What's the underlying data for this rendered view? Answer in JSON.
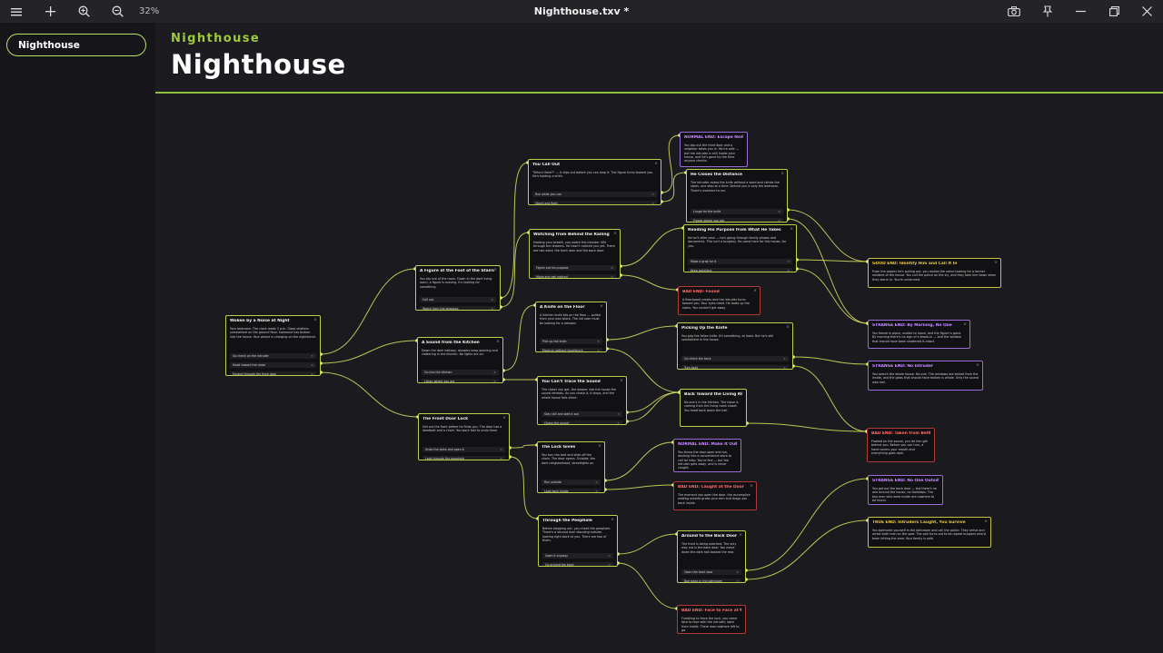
{
  "window": {
    "title": "Nighthouse.txv *",
    "zoom": "32%"
  },
  "toolbar": {
    "icons": [
      "menu-icon",
      "plus-icon",
      "zoom-in-icon",
      "zoom-out-icon",
      "camera-icon",
      "pin-icon",
      "minimize-icon",
      "restore-icon",
      "close-icon"
    ]
  },
  "sidebar": {
    "items": [
      {
        "label": "Nighthouse"
      }
    ]
  },
  "header": {
    "subtitle": "Nighthouse",
    "title": "Nighthouse"
  },
  "colors": {
    "accent": "#9ecb3c",
    "node_border": "#b8d245",
    "edge": "#d8e060",
    "normal_end": "#c58cff",
    "bad_end": "#ff6a6a",
    "good_end": "#e8c640",
    "strange_end": "#c58cff",
    "true_end": "#e8c640"
  },
  "nodes": [
    {
      "id": "n1",
      "kind": "story",
      "title": "Woken by a Noise at Night",
      "body": "Your bedroom. The clock reads 3 a.m. Glass shatters somewhere on the ground floor. Someone has broken into the house. Your phone is charging on the nightstand.",
      "choices": [
        "Go check on the intruder",
        "Head toward the noise",
        "Escape through the front door"
      ]
    },
    {
      "id": "n2",
      "kind": "story",
      "title": "A Figure at the Foot of the Stairs",
      "body": "You slip out of the room. Down in the dark living room, a figure is moving. It's looking for something.",
      "choices": [
        "Call out",
        "Watch from the shadows"
      ]
    },
    {
      "id": "n3",
      "kind": "story",
      "title": "A Sound from the Kitchen",
      "body": "Down the dark hallway, drawers keep opening and clattering in the kitchen. No lights are on.",
      "choices": [
        "Go into the kitchen",
        "Listen where you are"
      ]
    },
    {
      "id": "n4",
      "kind": "story",
      "title": "The Front Door Lock",
      "body": "Get out the front before he finds you. The door has a deadbolt and a chain. You work fast to undo them.",
      "choices": [
        "Undo the locks and open it",
        "Look through the peephole"
      ]
    },
    {
      "id": "n5",
      "kind": "story",
      "title": "You Call Out",
      "body": "\"Who's there?\" — It slips out before you can stop it. The figure turns toward you. He's holding a knife.",
      "choices": [
        "Run while you can",
        "Stand and fight"
      ]
    },
    {
      "id": "n6",
      "kind": "story",
      "title": "Watching from Behind the Railing",
      "body": "Holding your breath, you watch the intruder rifle through the drawers. He hasn't noticed you yet. There are two exits: the front door and the back door.",
      "choices": [
        "Figure out his purpose",
        "Move and get noticed"
      ]
    },
    {
      "id": "n7",
      "kind": "story",
      "title": "A Knife on the Floor",
      "body": "A kitchen knife lies on the floor — pulled from your own block. The intruder must be looking for a weapon.",
      "choices": [
        "Pick up the knife",
        "Move on without touching it"
      ]
    },
    {
      "id": "n8",
      "kind": "story",
      "title": "You Can't Trace the Sound",
      "body": "The closer you get, the deeper into the house the sound retreats. As you chase it, it stops, and the whole house falls silent.",
      "choices": [
        "Stay still and wait it out",
        "Chase the sound"
      ]
    },
    {
      "id": "n9",
      "kind": "story",
      "title": "The Lock Gives",
      "body": "You turn the bolt and slide off the chain. The door opens. Outside, the dark neighborhood, streetlights on.",
      "choices": [
        "Run outside",
        "Look back inside"
      ]
    },
    {
      "id": "n10",
      "kind": "story",
      "title": "Through the Peephole",
      "body": "Before stepping out, you check the peephole. There's a second man standing outside, looking right back at you. There are two of them.",
      "choices": [
        "Open it anyway",
        "Go around the back"
      ]
    },
    {
      "id": "n11",
      "kind": "normal",
      "title": "NORMAL END: Escape Next Do",
      "body": "You slip out the front door and a neighbor takes you in. You're safe — but the intruder is still inside your house, and he's gone by the time anyone checks.",
      "choices": []
    },
    {
      "id": "n12",
      "kind": "story",
      "title": "He Closes the Distance",
      "body": "The intruder raises the knife without a word and climbs the stairs, one step at a time. Behind you is only the bedroom. There's nowhere to run.",
      "choices": [
        "Lunge for the knife",
        "Freeze where you are"
      ]
    },
    {
      "id": "n13",
      "kind": "story",
      "title": "Reading His Purpose from What He Takes",
      "body": "He isn't after cash — he's going through family photos and documents. This isn't a burglary. He came here for this house, for you.",
      "choices": [
        "Make a grab for it",
        "Keep watching"
      ]
    },
    {
      "id": "n14",
      "kind": "bad",
      "title": "BAD END: Found",
      "body": "A floorboard creaks and the intruder turns toward you. Your eyes meet. He looks up the stairs. You couldn't get away.",
      "choices": []
    },
    {
      "id": "n15",
      "kind": "story",
      "title": "Picking Up the Knife",
      "body": "You grip the fallen knife. It's something, at least. But he's still somewhere in the house.",
      "choices": [
        "Go check the back",
        "Turn back"
      ]
    },
    {
      "id": "n16",
      "kind": "story",
      "title": "Back Toward the Living Room",
      "body": "No one's in the kitchen. The noise is coming from the living room closet. You head back down the hall.",
      "choices": []
    },
    {
      "id": "n17",
      "kind": "normal",
      "title": "NORMAL END: Make It Outside",
      "body": "You throw the door open and run, dashing into a convenience store to call for help. You're fine — but the intruder gets away, and is never caught.",
      "choices": []
    },
    {
      "id": "n18",
      "kind": "bad",
      "title": "BAD END: Caught at the Door",
      "body": "The moment you open the door, the accomplice waiting outside grabs your arm and drags you back inside.",
      "choices": []
    },
    {
      "id": "n19",
      "kind": "story",
      "title": "Around to the Back Door",
      "body": "The front is being watched. The only way out is the back door. You move down the dark hall toward the rear.",
      "choices": [
        "Open the back door",
        "Barricade in the bathroom"
      ]
    },
    {
      "id": "n20",
      "kind": "bad",
      "title": "BAD END: Face to Face at the E",
      "body": "Fumbling to force the lock, you come face to face with the intruder, back from inside. There was nowhere left to go.",
      "choices": []
    },
    {
      "id": "n21",
      "kind": "good",
      "title": "GOOD END: Identify Him and Call It In",
      "body": "From the papers he's pulling out, you realize the name looking for a former resident of the house. You call the police on the sly, and they take him down when they storm in. You're unharmed.",
      "choices": []
    },
    {
      "id": "n22",
      "kind": "normal",
      "title": "STRANGE END: By Morning, No One",
      "body": "You freeze in place, unable to move, and the figure is gone. By morning there's no sign of a break-in — and the window that should have been shattered is intact.",
      "choices": []
    },
    {
      "id": "n23",
      "kind": "normal",
      "title": "STRANGE END: No Intruder",
      "body": "You search the whole house. No one. The windows are locked from the inside, and the glass that should have broken is whole. Only the sound was real.",
      "choices": []
    },
    {
      "id": "n24",
      "kind": "bad",
      "title": "BAD END: Taken from Behind",
      "body": "Fixated on the sound, you let him get behind you. Before you can turn, a hand covers your mouth and everything goes dark.",
      "choices": []
    },
    {
      "id": "n25",
      "kind": "normal",
      "title": "STRANGE END: No One Outside",
      "body": "You got out the back door — but there's no one around the house, no footsteps. The two men who were inside are nowhere to be found.",
      "choices": []
    },
    {
      "id": "n26",
      "kind": "good",
      "title": "TRUE END: Intruders Caught, You Survive",
      "body": "You barricade yourself in the bathroom and call the police. They arrive and arrest both men on the spot. The pair turns out to be repeat burglars who'd been hitting the area. Your family is safe.",
      "choices": []
    }
  ]
}
